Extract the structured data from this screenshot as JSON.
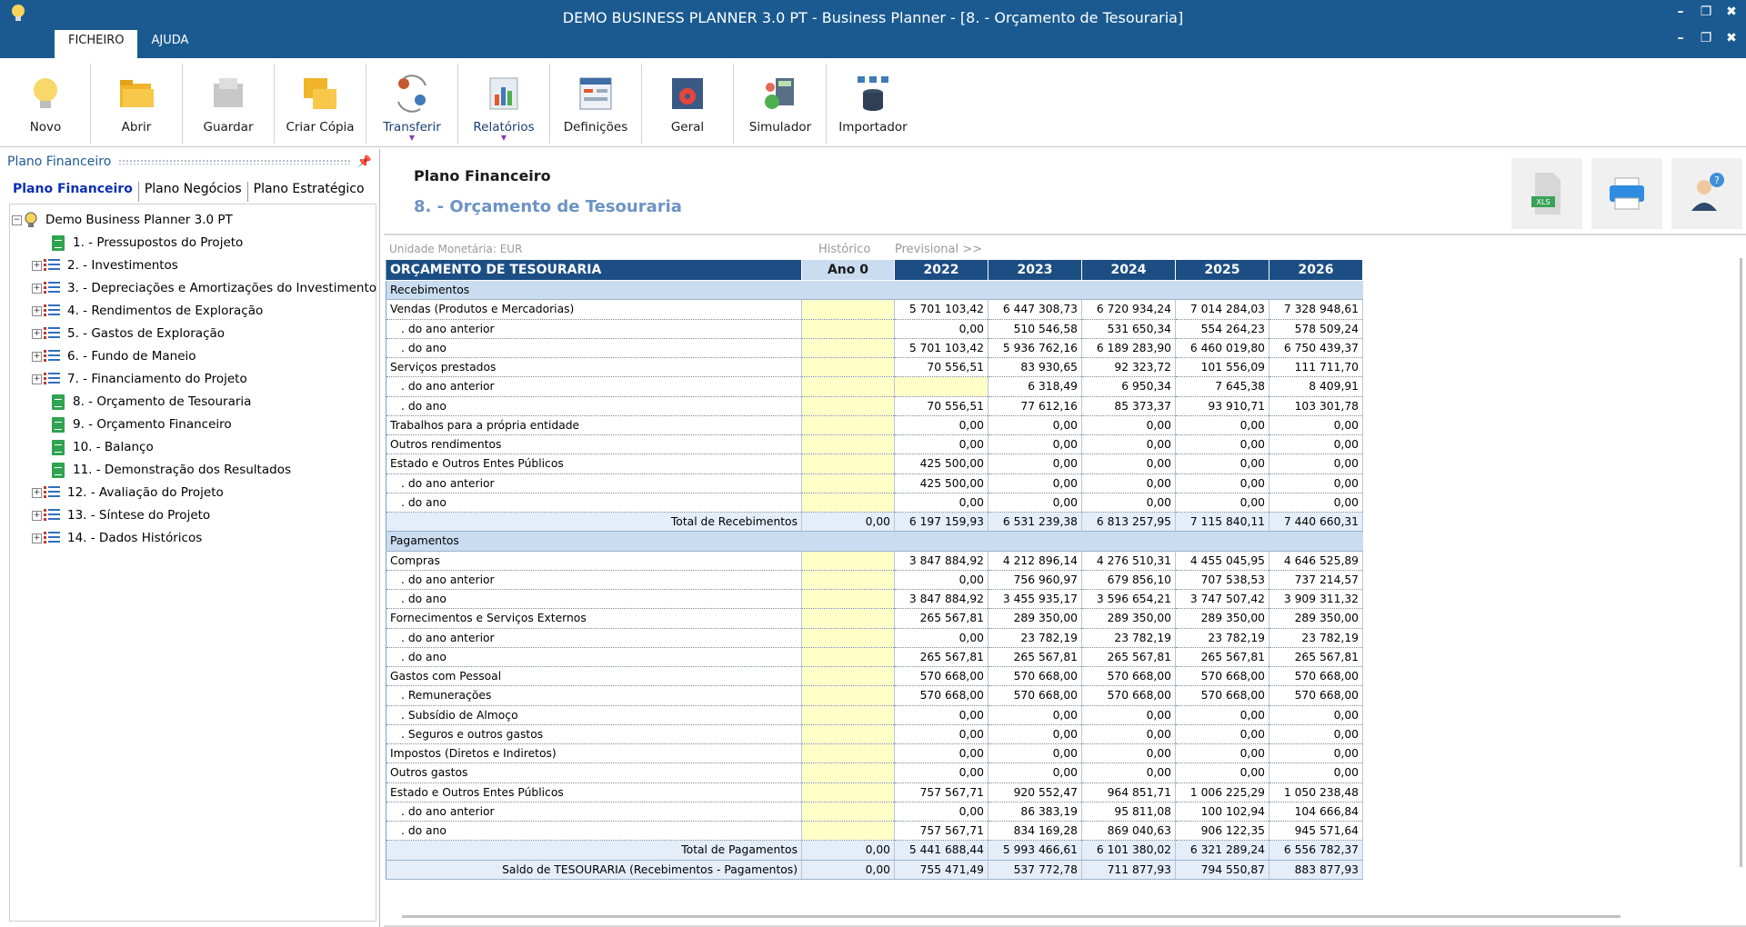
{
  "window": {
    "title": "DEMO BUSINESS PLANNER 3.0 PT - Business Planner - [8. - Orçamento de Tesouraria]",
    "minimize": "–",
    "restore": "❐",
    "close": "✖"
  },
  "menu_tabs": [
    "FICHEIRO",
    "AJUDA"
  ],
  "ribbon": [
    "Novo",
    "Abrir",
    "Guardar",
    "Criar Cópia",
    "Transferir",
    "Relatórios",
    "Definições",
    "Geral",
    "Simulador",
    "Importador"
  ],
  "left_panel": {
    "title": "Plano Financeiro",
    "pin": "📌",
    "tabs": [
      "Plano Financeiro",
      "Plano Negócios",
      "Plano Estratégico"
    ],
    "root": "Demo Business Planner 3.0 PT",
    "items": [
      "1. - Pressupostos do Projeto",
      "2. - Investimentos",
      "3. - Depreciações e Amortizações do Investimento",
      "4. - Rendimentos de Exploração",
      "5. - Gastos de Exploração",
      "6. - Fundo de Maneio",
      "7. - Financiamento do Projeto",
      "8. - Orçamento de Tesouraria",
      "9. - Orçamento Financeiro",
      "10. - Balanço",
      "11. - Demonstração dos Resultados",
      "12. - Avaliação do Projeto",
      "13. - Síntese do Projeto",
      "14. - Dados Históricos"
    ]
  },
  "main": {
    "title": "Plano Financeiro",
    "subtitle": "8. - Orçamento de Tesouraria",
    "xls_label": "XLS",
    "unit": "Unidade Monetária: EUR",
    "historico": "Histórico",
    "previsional": "Previsional >>"
  },
  "table": {
    "header": [
      "ORÇAMENTO DE TESOURARIA",
      "Ano 0",
      "2022",
      "2023",
      "2024",
      "2025",
      "2026"
    ],
    "rows": [
      {
        "t": "sec",
        "label": "Recebimentos"
      },
      {
        "t": "row",
        "label": "Vendas (Produtos e Mercadorias)",
        "v": [
          "",
          "5 701 103,42",
          "6 447 308,73",
          "6 720 934,24",
          "7 014 284,03",
          "7 328 948,61"
        ]
      },
      {
        "t": "sub",
        "label": ". do ano anterior",
        "v": [
          "",
          "0,00",
          "510 546,58",
          "531 650,34",
          "554 264,23",
          "578 509,24"
        ]
      },
      {
        "t": "sub",
        "label": ". do ano",
        "v": [
          "",
          "5 701 103,42",
          "5 936 762,16",
          "6 189 283,90",
          "6 460 019,80",
          "6 750 439,37"
        ]
      },
      {
        "t": "row",
        "label": "Serviços prestados",
        "v": [
          "",
          "70 556,51",
          "83 930,65",
          "92 323,72",
          "101 556,09",
          "111 711,70"
        ]
      },
      {
        "t": "sub",
        "label": ". do ano anterior",
        "v": [
          "",
          "",
          "6 318,49",
          "6 950,34",
          "7 645,38",
          "8 409,91"
        ],
        "yel2": true
      },
      {
        "t": "sub",
        "label": ". do ano",
        "v": [
          "",
          "70 556,51",
          "77 612,16",
          "85 373,37",
          "93 910,71",
          "103 301,78"
        ]
      },
      {
        "t": "row",
        "label": "Trabalhos para a própria entidade",
        "v": [
          "",
          "0,00",
          "0,00",
          "0,00",
          "0,00",
          "0,00"
        ]
      },
      {
        "t": "row",
        "label": "Outros rendimentos",
        "v": [
          "",
          "0,00",
          "0,00",
          "0,00",
          "0,00",
          "0,00"
        ]
      },
      {
        "t": "row",
        "label": "Estado e Outros Entes Públicos",
        "v": [
          "",
          "425 500,00",
          "0,00",
          "0,00",
          "0,00",
          "0,00"
        ]
      },
      {
        "t": "sub",
        "label": ". do ano anterior",
        "v": [
          "",
          "425 500,00",
          "0,00",
          "0,00",
          "0,00",
          "0,00"
        ]
      },
      {
        "t": "sub",
        "label": ". do ano",
        "v": [
          "",
          "0,00",
          "0,00",
          "0,00",
          "0,00",
          "0,00"
        ]
      },
      {
        "t": "tot",
        "label": "Total de Recebimentos",
        "v": [
          "0,00",
          "6 197 159,93",
          "6 531 239,38",
          "6 813 257,95",
          "7 115 840,11",
          "7 440 660,31"
        ]
      },
      {
        "t": "sec",
        "label": "Pagamentos"
      },
      {
        "t": "row",
        "label": "Compras",
        "v": [
          "",
          "3 847 884,92",
          "4 212 896,14",
          "4 276 510,31",
          "4 455 045,95",
          "4 646 525,89"
        ]
      },
      {
        "t": "sub",
        "label": ". do ano anterior",
        "v": [
          "",
          "0,00",
          "756 960,97",
          "679 856,10",
          "707 538,53",
          "737 214,57"
        ]
      },
      {
        "t": "sub",
        "label": ". do ano",
        "v": [
          "",
          "3 847 884,92",
          "3 455 935,17",
          "3 596 654,21",
          "3 747 507,42",
          "3 909 311,32"
        ]
      },
      {
        "t": "row",
        "label": "Fornecimentos e Serviços Externos",
        "v": [
          "",
          "265 567,81",
          "289 350,00",
          "289 350,00",
          "289 350,00",
          "289 350,00"
        ]
      },
      {
        "t": "sub",
        "label": ". do ano anterior",
        "v": [
          "",
          "0,00",
          "23 782,19",
          "23 782,19",
          "23 782,19",
          "23 782,19"
        ]
      },
      {
        "t": "sub",
        "label": ". do ano",
        "v": [
          "",
          "265 567,81",
          "265 567,81",
          "265 567,81",
          "265 567,81",
          "265 567,81"
        ]
      },
      {
        "t": "row",
        "label": "Gastos com Pessoal",
        "v": [
          "",
          "570 668,00",
          "570 668,00",
          "570 668,00",
          "570 668,00",
          "570 668,00"
        ]
      },
      {
        "t": "sub",
        "label": ". Remunerações",
        "v": [
          "",
          "570 668,00",
          "570 668,00",
          "570 668,00",
          "570 668,00",
          "570 668,00"
        ]
      },
      {
        "t": "sub",
        "label": ". Subsídio de Almoço",
        "v": [
          "",
          "0,00",
          "0,00",
          "0,00",
          "0,00",
          "0,00"
        ]
      },
      {
        "t": "sub",
        "label": ". Seguros e outros gastos",
        "v": [
          "",
          "0,00",
          "0,00",
          "0,00",
          "0,00",
          "0,00"
        ]
      },
      {
        "t": "row",
        "label": "Impostos (Diretos e Indiretos)",
        "v": [
          "",
          "0,00",
          "0,00",
          "0,00",
          "0,00",
          "0,00"
        ]
      },
      {
        "t": "row",
        "label": "Outros gastos",
        "v": [
          "",
          "0,00",
          "0,00",
          "0,00",
          "0,00",
          "0,00"
        ]
      },
      {
        "t": "row",
        "label": "Estado e Outros Entes Públicos",
        "v": [
          "",
          "757 567,71",
          "920 552,47",
          "964 851,71",
          "1 006 225,29",
          "1 050 238,48"
        ]
      },
      {
        "t": "sub",
        "label": ". do ano anterior",
        "v": [
          "",
          "0,00",
          "86 383,19",
          "95 811,08",
          "100 102,94",
          "104 666,84"
        ]
      },
      {
        "t": "sub",
        "label": ". do ano",
        "v": [
          "",
          "757 567,71",
          "834 169,28",
          "869 040,63",
          "906 122,35",
          "945 571,64"
        ]
      },
      {
        "t": "tot",
        "label": "Total de Pagamentos",
        "v": [
          "0,00",
          "5 441 688,44",
          "5 993 466,61",
          "6 101 380,02",
          "6 321 289,24",
          "6 556 782,37"
        ]
      },
      {
        "t": "tot",
        "label": "Saldo de TESOURARIA (Recebimentos - Pagamentos)",
        "v": [
          "0,00",
          "755 471,49",
          "537 772,78",
          "711 877,93",
          "794 550,87",
          "883 877,93"
        ]
      }
    ]
  }
}
